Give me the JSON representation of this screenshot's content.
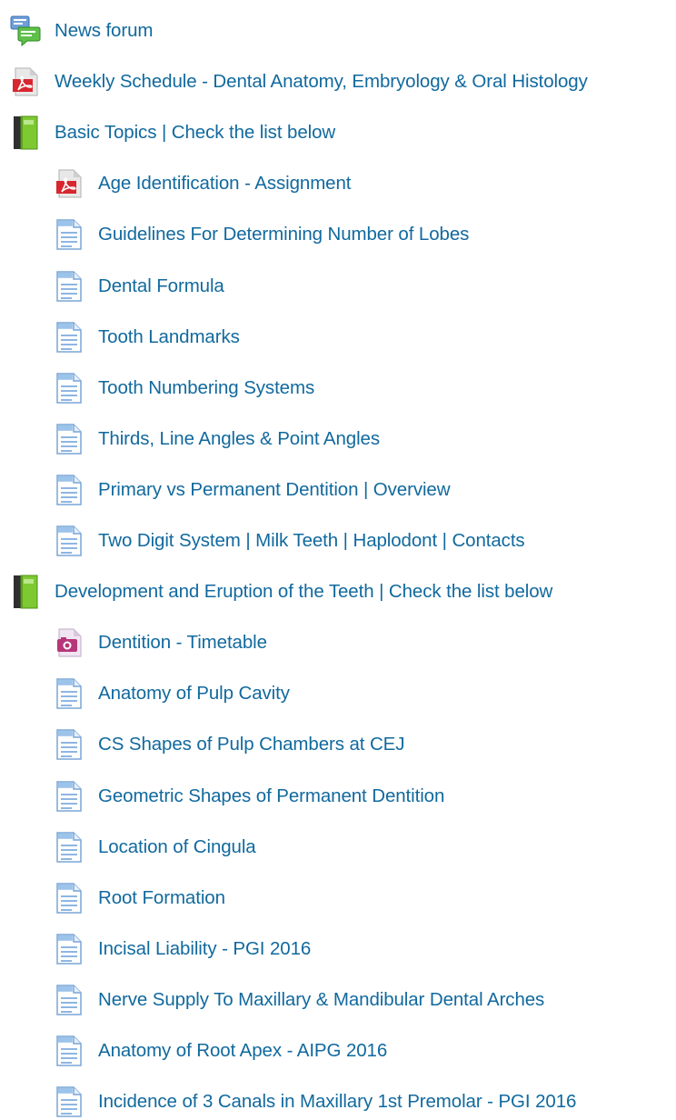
{
  "items": [
    {
      "label": "News forum",
      "icon": "forum-icon",
      "level": 0
    },
    {
      "label": "Weekly Schedule - Dental Anatomy, Embryology & Oral Histology",
      "icon": "pdf-icon",
      "level": 0
    },
    {
      "label": "Basic Topics | Check the list below",
      "icon": "book-icon",
      "level": 0
    },
    {
      "label": "Age Identification - Assignment",
      "icon": "pdf-icon",
      "level": 1
    },
    {
      "label": "Guidelines For Determining Number of Lobes",
      "icon": "page-icon",
      "level": 1
    },
    {
      "label": "Dental Formula",
      "icon": "page-icon",
      "level": 1
    },
    {
      "label": "Tooth Landmarks",
      "icon": "page-icon",
      "level": 1
    },
    {
      "label": "Tooth Numbering Systems",
      "icon": "page-icon",
      "level": 1
    },
    {
      "label": "Thirds, Line Angles & Point Angles",
      "icon": "page-icon",
      "level": 1
    },
    {
      "label": "Primary vs Permanent Dentition | Overview",
      "icon": "page-icon",
      "level": 1
    },
    {
      "label": "Two Digit System | Milk Teeth | Haplodont | Contacts",
      "icon": "page-icon",
      "level": 1
    },
    {
      "label": "Development and Eruption of the Teeth | Check the list below",
      "icon": "book-icon",
      "level": 0
    },
    {
      "label": "Dentition - Timetable",
      "icon": "image-icon",
      "level": 1
    },
    {
      "label": "Anatomy of Pulp Cavity",
      "icon": "page-icon",
      "level": 1
    },
    {
      "label": "CS Shapes of Pulp Chambers at CEJ",
      "icon": "page-icon",
      "level": 1
    },
    {
      "label": "Geometric Shapes of Permanent Dentition",
      "icon": "page-icon",
      "level": 1
    },
    {
      "label": "Location of Cingula",
      "icon": "page-icon",
      "level": 1
    },
    {
      "label": "Root Formation",
      "icon": "page-icon",
      "level": 1
    },
    {
      "label": "Incisal Liability - PGI 2016",
      "icon": "page-icon",
      "level": 1
    },
    {
      "label": "Nerve Supply To Maxillary & Mandibular Dental Arches",
      "icon": "page-icon",
      "level": 1
    },
    {
      "label": "Anatomy of Root Apex - AIPG 2016",
      "icon": "page-icon",
      "level": 1
    },
    {
      "label": "Incidence of 3 Canals in Maxillary 1st Premolar - PGI 2016",
      "icon": "page-icon",
      "level": 1
    }
  ],
  "colors": {
    "link": "#11699e"
  }
}
